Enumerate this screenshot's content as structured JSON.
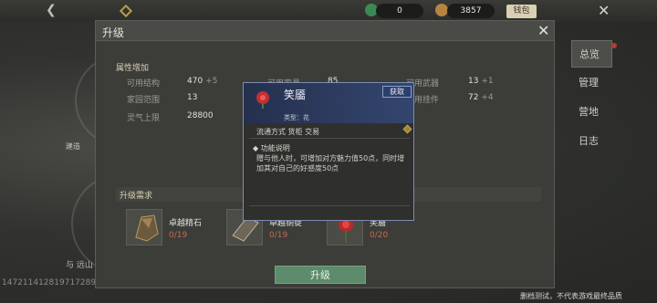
{
  "topbar": {
    "currency1": "0",
    "currency2": "3857",
    "wallet_label": "钱包"
  },
  "side_menu": [
    "总览",
    "管理",
    "营地",
    "日志"
  ],
  "background": {
    "left_label_1": "建造",
    "left_label_2": "与 远山"
  },
  "footer": {
    "uid": "147211412819717289",
    "note": "删档测试，不代表游戏最终品质"
  },
  "dialog": {
    "title": "升级",
    "section_attr": "属性增加",
    "stats": [
      {
        "label": "可用结构",
        "value": "470",
        "plus": "+5"
      },
      {
        "label": "可用家具",
        "value": "85",
        "plus": ""
      },
      {
        "label": "可用武器",
        "value": "13",
        "plus": "+1"
      },
      {
        "label": "家园范围",
        "value": "13",
        "plus": ""
      },
      {
        "label": "可用挂件",
        "value": "72",
        "plus": "+4"
      },
      {
        "label": "灵气上限",
        "value": "28800",
        "plus": ""
      }
    ],
    "section_req": "升级需求",
    "items": [
      {
        "name": "卓越精石",
        "count": "0/19"
      },
      {
        "name": "卓越铜锭",
        "count": "0/19"
      },
      {
        "name": "笑靥",
        "count": "0/20"
      }
    ],
    "upgrade_label": "升级"
  },
  "tooltip": {
    "name": "笑靥",
    "get_label": "获取",
    "type": "类型：花",
    "circulation": "流通方式   货柜 交易",
    "func_title": "功能说明",
    "desc": "赠与他人时，可增加对方魅力值50点，同时增加其对自己的好感度50点"
  }
}
